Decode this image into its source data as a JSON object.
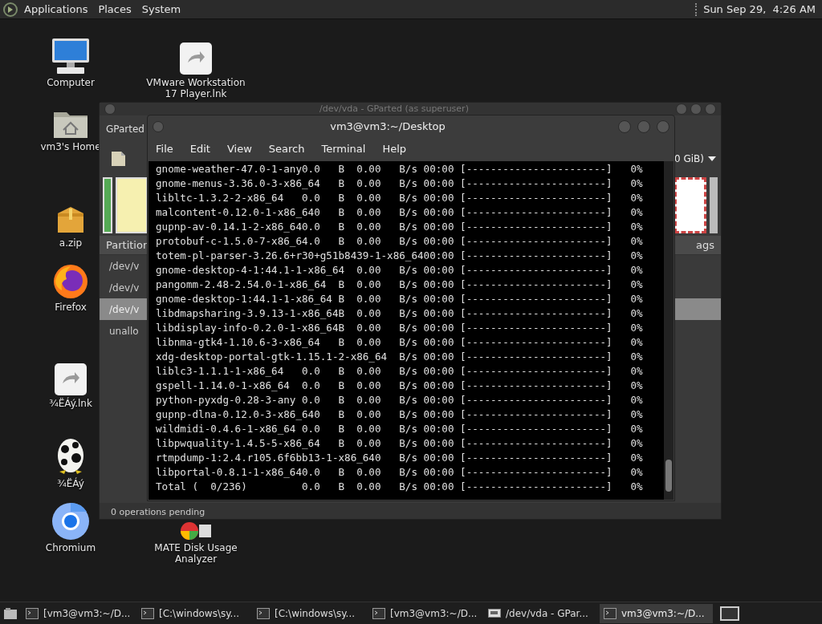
{
  "top_panel": {
    "menus": [
      "Applications",
      "Places",
      "System"
    ],
    "clock": "Sun Sep 29,  4:26 AM"
  },
  "desktop_icons": [
    {
      "kind": "computer",
      "label": "Computer"
    },
    {
      "kind": "link",
      "label": "VMware Workstation 17 Player.lnk"
    },
    {
      "kind": "home",
      "label": "vm3's Home"
    },
    {
      "kind": "zip",
      "label": "a.zip"
    },
    {
      "kind": "firefox",
      "label": "Firefox"
    },
    {
      "kind": "link",
      "label": "¾ËÁý.lnk"
    },
    {
      "kind": "egg",
      "label": "¾ËÁý"
    },
    {
      "kind": "chromium",
      "label": "Chromium"
    },
    {
      "kind": "disk",
      "label": "MATE Disk Usage Analyzer"
    }
  ],
  "gparted": {
    "title": "/dev/vda - GParted (as superuser)",
    "menu": "GParted",
    "device": "0 GiB)",
    "columns": [
      "Partition",
      "ags"
    ],
    "rows": [
      {
        "text": "/dev/v",
        "selected": false
      },
      {
        "text": "/dev/v",
        "selected": false
      },
      {
        "text": "/dev/v",
        "selected": true
      },
      {
        "text": "unallo",
        "selected": false
      }
    ],
    "status": "0 operations pending"
  },
  "terminal": {
    "title": "vm3@vm3:~/Desktop",
    "menu": [
      "File",
      "Edit",
      "View",
      "Search",
      "Terminal",
      "Help"
    ],
    "lines": [
      "gnome-weather-47.0-1-any0.0   B  0.00   B/s 00:00 [-----------------------]   0%",
      "gnome-menus-3.36.0-3-x86_64   B  0.00   B/s 00:00 [-----------------------]   0%",
      "libltc-1.3.2-2-x86_64   0.0   B  0.00   B/s 00:00 [-----------------------]   0%",
      "malcontent-0.12.0-1-x86_640   B  0.00   B/s 00:00 [-----------------------]   0%",
      "gupnp-av-0.14.1-2-x86_640.0   B  0.00   B/s 00:00 [-----------------------]   0%",
      "protobuf-c-1.5.0-7-x86_64.0   B  0.00   B/s 00:00 [-----------------------]   0%",
      "totem-pl-parser-3.26.6+r30+g51b8439-1-x86_6400:00 [-----------------------]   0%",
      "gnome-desktop-4-1:44.1-1-x86_64  0.00   B/s 00:00 [-----------------------]   0%",
      "pangomm-2.48-2.54.0-1-x86_64  B  0.00   B/s 00:00 [-----------------------]   0%",
      "gnome-desktop-1:44.1-1-x86_64 B  0.00   B/s 00:00 [-----------------------]   0%",
      "libdmapsharing-3.9.13-1-x86_64B  0.00   B/s 00:00 [-----------------------]   0%",
      "libdisplay-info-0.2.0-1-x86_64B  0.00   B/s 00:00 [-----------------------]   0%",
      "libnma-gtk4-1.10.6-3-x86_64   B  0.00   B/s 00:00 [-----------------------]   0%",
      "xdg-desktop-portal-gtk-1.15.1-2-x86_64  B/s 00:00 [-----------------------]   0%",
      "liblc3-1.1.1-1-x86_64   0.0   B  0.00   B/s 00:00 [-----------------------]   0%",
      "gspell-1.14.0-1-x86_64  0.0   B  0.00   B/s 00:00 [-----------------------]   0%",
      "python-pyxdg-0.28-3-any 0.0   B  0.00   B/s 00:00 [-----------------------]   0%",
      "gupnp-dlna-0.12.0-3-x86_640   B  0.00   B/s 00:00 [-----------------------]   0%",
      "wildmidi-0.4.6-1-x86_64 0.0   B  0.00   B/s 00:00 [-----------------------]   0%",
      "libpwquality-1.4.5-5-x86_64   B  0.00   B/s 00:00 [-----------------------]   0%",
      "rtmpdump-1:2.4.r105.6f6bb13-1-x86_640   B/s 00:00 [-----------------------]   0%",
      "libportal-0.8.1-1-x86_640.0   B  0.00   B/s 00:00 [-----------------------]   0%",
      "Total (  0/236)         0.0   B  0.00   B/s 00:00 [-----------------------]   0%"
    ]
  },
  "taskbar": {
    "tasks": [
      {
        "kind": "terminal",
        "label": "[vm3@vm3:~/D...",
        "selected": false
      },
      {
        "kind": "terminal",
        "label": "[C:\\windows\\sy...",
        "selected": false
      },
      {
        "kind": "terminal",
        "label": "[C:\\windows\\sy...",
        "selected": false
      },
      {
        "kind": "terminal",
        "label": "[vm3@vm3:~/D...",
        "selected": false
      },
      {
        "kind": "disk",
        "label": "/dev/vda - GPar...",
        "selected": false
      },
      {
        "kind": "terminal",
        "label": "vm3@vm3:~/D...",
        "selected": true
      }
    ]
  }
}
